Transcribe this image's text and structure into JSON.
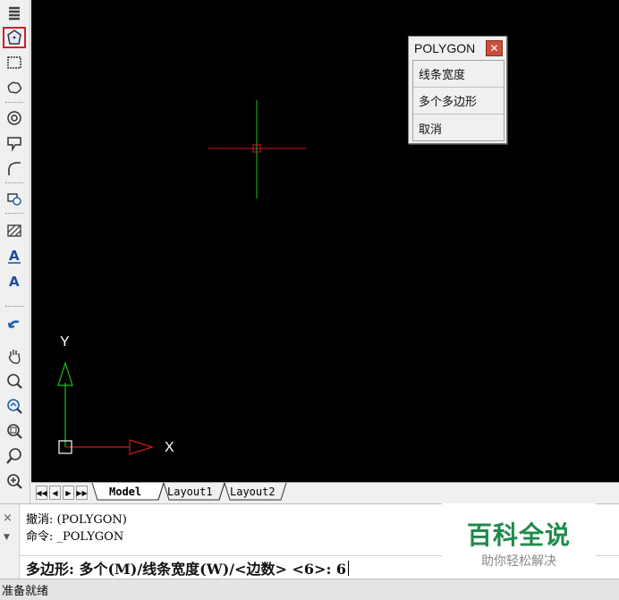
{
  "toolbar": {
    "items": [
      {
        "icon": "coil-icon"
      },
      {
        "icon": "polygon-icon",
        "active": true
      },
      {
        "icon": "rectangle-icon"
      },
      {
        "icon": "revision-cloud-icon"
      },
      {
        "icon": "donut-icon"
      },
      {
        "icon": "wipeout-icon"
      },
      {
        "icon": "polyline-icon"
      },
      {
        "icon": "block-insert-icon"
      },
      {
        "icon": "hatch-icon"
      },
      {
        "icon": "multiline-text-icon"
      },
      {
        "icon": "text-icon"
      },
      {
        "icon": "undo-icon"
      },
      {
        "icon": "pan-icon"
      },
      {
        "icon": "zoom-realtime-icon"
      },
      {
        "icon": "zoom-previous-icon"
      },
      {
        "icon": "zoom-window-icon"
      },
      {
        "icon": "zoom-dynamic-icon"
      },
      {
        "icon": "zoom-extents-icon"
      }
    ]
  },
  "canvas": {
    "ucs_y_label": "Y",
    "ucs_x_label": "X",
    "colors": {
      "background": "#000000",
      "crosshair_h": "#d01818",
      "crosshair_v": "#1fbf1f",
      "ucs_x": "#d01818",
      "ucs_y": "#1fbf1f"
    }
  },
  "context_menu": {
    "title": "POLYGON",
    "close_label": "✕",
    "items": [
      "线条宽度",
      "多个多边形",
      "取消"
    ]
  },
  "tabs": {
    "nav": [
      "◀◀",
      "◀",
      "▶",
      "▶▶"
    ],
    "items": [
      {
        "label": "Model",
        "active": true
      },
      {
        "label": "Layout1",
        "active": false
      },
      {
        "label": "Layout2",
        "active": false
      }
    ]
  },
  "command": {
    "close_label": "×",
    "history": [
      "撤消:  (POLYGON)",
      "命令:  _POLYGON"
    ],
    "prompt": "多边形: 多个(M)/线条宽度(W)/<边数> <6>: 6"
  },
  "watermark": {
    "title": "百科全说",
    "subtitle": "助你轻松解决"
  },
  "status": {
    "text": "准备就绪"
  }
}
